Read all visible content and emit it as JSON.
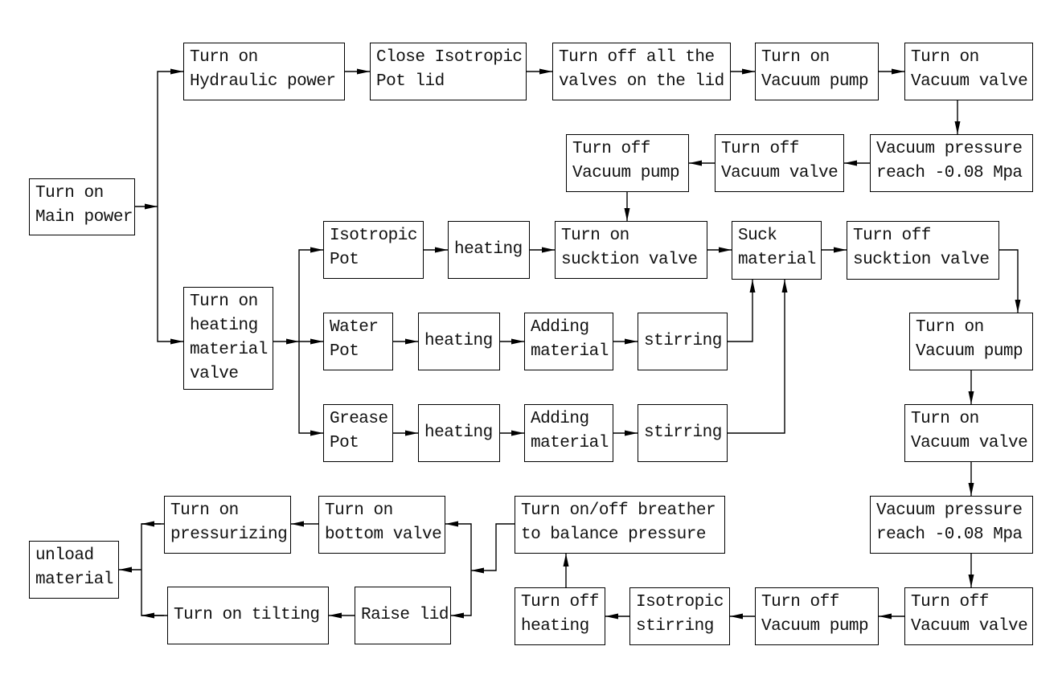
{
  "diagram": {
    "type": "process-flowchart",
    "nodes": [
      {
        "id": "main_power",
        "label": "Turn on\nMain power"
      },
      {
        "id": "hydraulic",
        "label": "Turn on\nHydraulic power"
      },
      {
        "id": "close_lid",
        "label": "Close Isotropic\nPot lid"
      },
      {
        "id": "valves_off",
        "label": "Turn off all the\nvalves on the lid"
      },
      {
        "id": "vpump_on_1",
        "label": "Turn on\nVacuum pump"
      },
      {
        "id": "vvalve_on_1",
        "label": "Turn on\nVacuum valve"
      },
      {
        "id": "vpress_1",
        "label": "Vacuum pressure\nreach -0.08 Mpa"
      },
      {
        "id": "vvalve_off_1",
        "label": "Turn off\nVacuum valve"
      },
      {
        "id": "vpump_off_1",
        "label": "Turn off\nVacuum pump"
      },
      {
        "id": "heat_valve",
        "label": "Turn on\nheating\nmaterial\nvalve"
      },
      {
        "id": "iso_pot",
        "label": "Isotropic\nPot"
      },
      {
        "id": "iso_heat",
        "label": "heating"
      },
      {
        "id": "suck_on",
        "label": "Turn on\nsucktion valve"
      },
      {
        "id": "suck_mat",
        "label": "Suck\nmaterial"
      },
      {
        "id": "suck_off",
        "label": "Turn off\nsucktion valve"
      },
      {
        "id": "water_pot",
        "label": "Water\nPot"
      },
      {
        "id": "water_heat",
        "label": "heating"
      },
      {
        "id": "water_add",
        "label": "Adding\nmaterial"
      },
      {
        "id": "water_stir",
        "label": "stirring"
      },
      {
        "id": "grease_pot",
        "label": "Grease\nPot"
      },
      {
        "id": "grease_heat",
        "label": "heating"
      },
      {
        "id": "grease_add",
        "label": "Adding\nmaterial"
      },
      {
        "id": "grease_stir",
        "label": "stirring"
      },
      {
        "id": "vpump_on_2",
        "label": "Turn on\nVacuum pump"
      },
      {
        "id": "vvalve_on_2",
        "label": "Turn on\nVacuum valve"
      },
      {
        "id": "vpress_2",
        "label": "Vacuum pressure\nreach -0.08 Mpa"
      },
      {
        "id": "vvalve_off_2",
        "label": "Turn off\nVacuum valve"
      },
      {
        "id": "vpump_off_2",
        "label": "Turn off\nVacuum pump"
      },
      {
        "id": "iso_stir",
        "label": "Isotropic\nstirring"
      },
      {
        "id": "heat_off",
        "label": "Turn off\nheating"
      },
      {
        "id": "breather",
        "label": "Turn on/off breather\nto balance pressure"
      },
      {
        "id": "bottom_valve",
        "label": "Turn on\nbottom valve"
      },
      {
        "id": "pressurizing",
        "label": "Turn on\npressurizing"
      },
      {
        "id": "raise_lid",
        "label": "Raise lid"
      },
      {
        "id": "tilting",
        "label": "Turn on tilting"
      },
      {
        "id": "unload",
        "label": "unload\nmaterial"
      }
    ],
    "edges": [
      [
        "main_power",
        "hydraulic"
      ],
      [
        "main_power",
        "heat_valve"
      ],
      [
        "hydraulic",
        "close_lid"
      ],
      [
        "close_lid",
        "valves_off"
      ],
      [
        "valves_off",
        "vpump_on_1"
      ],
      [
        "vpump_on_1",
        "vvalve_on_1"
      ],
      [
        "vvalve_on_1",
        "vpress_1"
      ],
      [
        "vpress_1",
        "vvalve_off_1"
      ],
      [
        "vvalve_off_1",
        "vpump_off_1"
      ],
      [
        "vpump_off_1",
        "suck_on"
      ],
      [
        "heat_valve",
        "iso_pot"
      ],
      [
        "heat_valve",
        "water_pot"
      ],
      [
        "heat_valve",
        "grease_pot"
      ],
      [
        "iso_pot",
        "iso_heat"
      ],
      [
        "iso_heat",
        "suck_on"
      ],
      [
        "suck_on",
        "suck_mat"
      ],
      [
        "water_pot",
        "water_heat"
      ],
      [
        "water_heat",
        "water_add"
      ],
      [
        "water_add",
        "water_stir"
      ],
      [
        "water_stir",
        "suck_mat"
      ],
      [
        "grease_pot",
        "grease_heat"
      ],
      [
        "grease_heat",
        "grease_add"
      ],
      [
        "grease_add",
        "grease_stir"
      ],
      [
        "grease_stir",
        "suck_mat"
      ],
      [
        "suck_mat",
        "suck_off"
      ],
      [
        "suck_off",
        "vpump_on_2"
      ],
      [
        "vpump_on_2",
        "vvalve_on_2"
      ],
      [
        "vvalve_on_2",
        "vpress_2"
      ],
      [
        "vpress_2",
        "vvalve_off_2"
      ],
      [
        "vvalve_off_2",
        "vpump_off_2"
      ],
      [
        "vpump_off_2",
        "iso_stir"
      ],
      [
        "iso_stir",
        "heat_off"
      ],
      [
        "heat_off",
        "breather"
      ],
      [
        "breather",
        "bottom_valve"
      ],
      [
        "breather",
        "raise_lid"
      ],
      [
        "bottom_valve",
        "pressurizing"
      ],
      [
        "raise_lid",
        "tilting"
      ],
      [
        "pressurizing",
        "unload"
      ],
      [
        "tilting",
        "unload"
      ]
    ],
    "colors": {
      "line": "#000000",
      "box_fill": "#ffffff",
      "text": "#111111"
    }
  }
}
